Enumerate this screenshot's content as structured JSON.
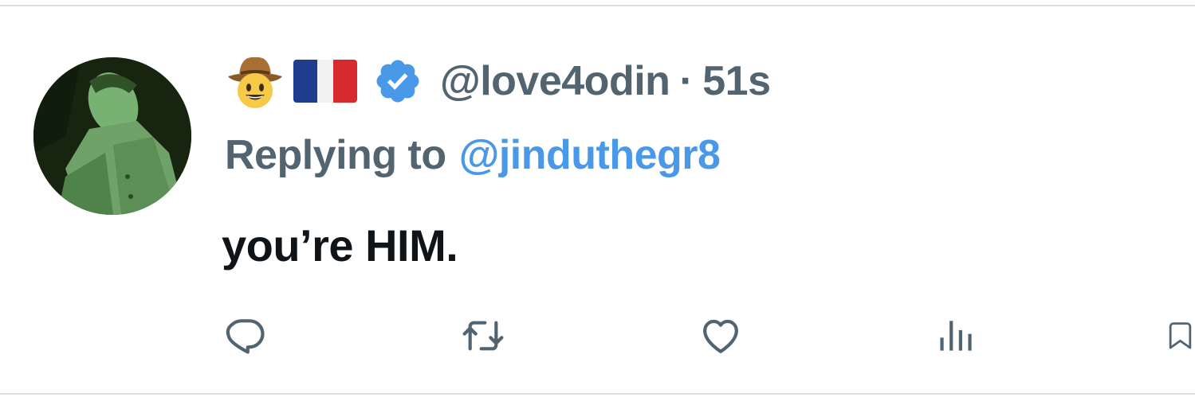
{
  "tweet": {
    "display_name_emojis": [
      "cowboy-hat-face-emoji",
      "france-flag-emoji"
    ],
    "handle": "@love4odin",
    "separator": "·",
    "time": "51s",
    "replying_to_prefix": "Replying to",
    "replying_to_handle": "@jinduthegr8",
    "text": "you’re HIM."
  },
  "actions": {
    "icons": [
      "reply-icon",
      "retweet-icon",
      "like-icon",
      "views-icon",
      "bookmark-icon"
    ]
  },
  "colors": {
    "secondary_text": "#536471",
    "link": "#4a99e9",
    "primary_text": "#0f1419",
    "verified": "#4a99e9",
    "divider": "#dcdcdc"
  }
}
